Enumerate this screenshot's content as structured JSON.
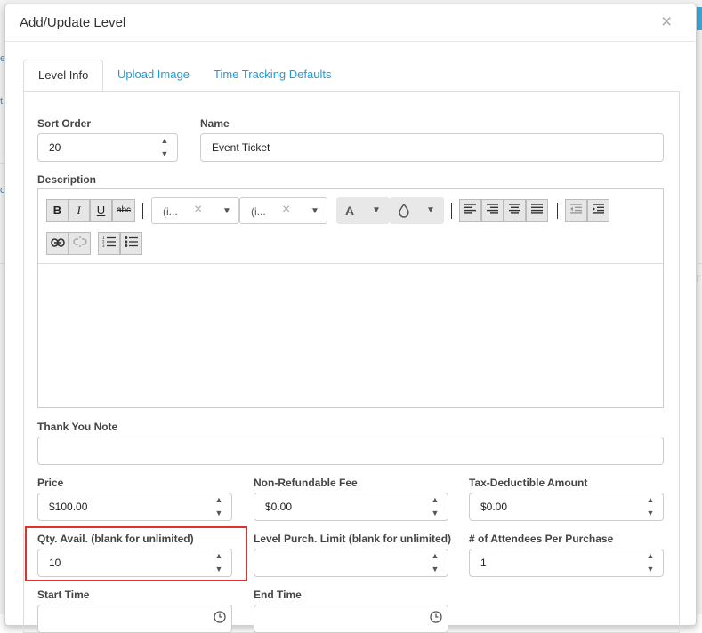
{
  "modal": {
    "title": "Add/Update Level",
    "close": "×"
  },
  "tabs": [
    {
      "label": "Level Info",
      "active": true
    },
    {
      "label": "Upload Image",
      "active": false
    },
    {
      "label": "Time Tracking Defaults",
      "active": false
    }
  ],
  "form": {
    "sort_order": {
      "label": "Sort Order",
      "value": "20"
    },
    "name": {
      "label": "Name",
      "value": "Event Ticket"
    },
    "description": {
      "label": "Description",
      "toolbar": {
        "bold": "B",
        "italic": "I",
        "underline": "U",
        "strike": "abc",
        "font_family": "(i...",
        "font_size": "(i...",
        "clear": "×",
        "font_color": "A",
        "highlight_icon": "droplet-icon",
        "caret": "▼"
      },
      "content": ""
    },
    "thank_you_note": {
      "label": "Thank You Note",
      "value": ""
    },
    "price": {
      "label": "Price",
      "value": "$100.00"
    },
    "non_refundable_fee": {
      "label": "Non-Refundable Fee",
      "value": "$0.00"
    },
    "tax_deductible": {
      "label": "Tax-Deductible Amount",
      "value": "$0.00"
    },
    "qty_avail": {
      "label": "Qty. Avail. (blank for unlimited)",
      "value": "10"
    },
    "purch_limit": {
      "label": "Level Purch. Limit (blank for unlimited)",
      "value": ""
    },
    "attendees": {
      "label": "# of Attendees Per Purchase",
      "value": "1"
    },
    "start_time": {
      "label": "Start Time",
      "value": ""
    },
    "end_time": {
      "label": "End Time",
      "value": ""
    }
  },
  "spinner": {
    "up": "▲",
    "down": "▼"
  },
  "colors": {
    "accent": "#1e9bd7",
    "highlight": "#e03030"
  }
}
